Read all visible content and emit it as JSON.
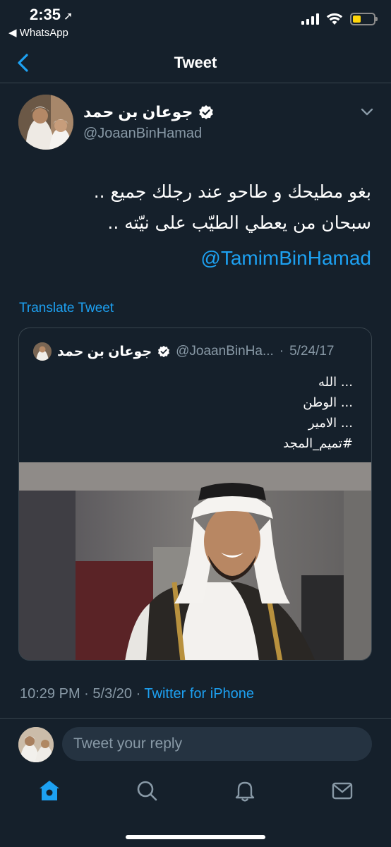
{
  "status_bar": {
    "time": "2:35",
    "back_app": "◀ WhatsApp",
    "battery_level": 0.4,
    "battery_color": "#ffd60a"
  },
  "nav": {
    "title": "Tweet",
    "back_icon": "chevron-left-icon"
  },
  "tweet": {
    "author_name": "جوعان بن حمد",
    "author_handle": "@JoaanBinHamad",
    "verified": true,
    "text_line_1": "بغو مطيحك و طاحو عند رجلك جميع ..",
    "text_line_2": "سبحان من يعطي الطيّب على نيّته ..",
    "mention": "@TamimBinHamad",
    "translate_label": "Translate Tweet",
    "time": "10:29 PM",
    "date": "5/3/20",
    "source": "Twitter for iPhone"
  },
  "quoted_tweet": {
    "author_name": "جوعان بن حمد",
    "author_handle": "@JoaanBinHa...",
    "separator": "·",
    "date": "5/24/17",
    "lines": [
      "... الله",
      "... الوطن",
      "... الامير",
      "#تميم_المجد"
    ]
  },
  "reply": {
    "placeholder": "Tweet your reply"
  },
  "tabbar": {
    "items": [
      {
        "name": "home",
        "icon": "home-icon",
        "active": true
      },
      {
        "name": "search",
        "icon": "search-icon",
        "active": false
      },
      {
        "name": "notifications",
        "icon": "bell-icon",
        "active": false
      },
      {
        "name": "messages",
        "icon": "mail-icon",
        "active": false
      }
    ]
  },
  "colors": {
    "background": "#15202b",
    "accent": "#1da1f2",
    "secondary_text": "#8899a6",
    "border": "#38444d"
  }
}
